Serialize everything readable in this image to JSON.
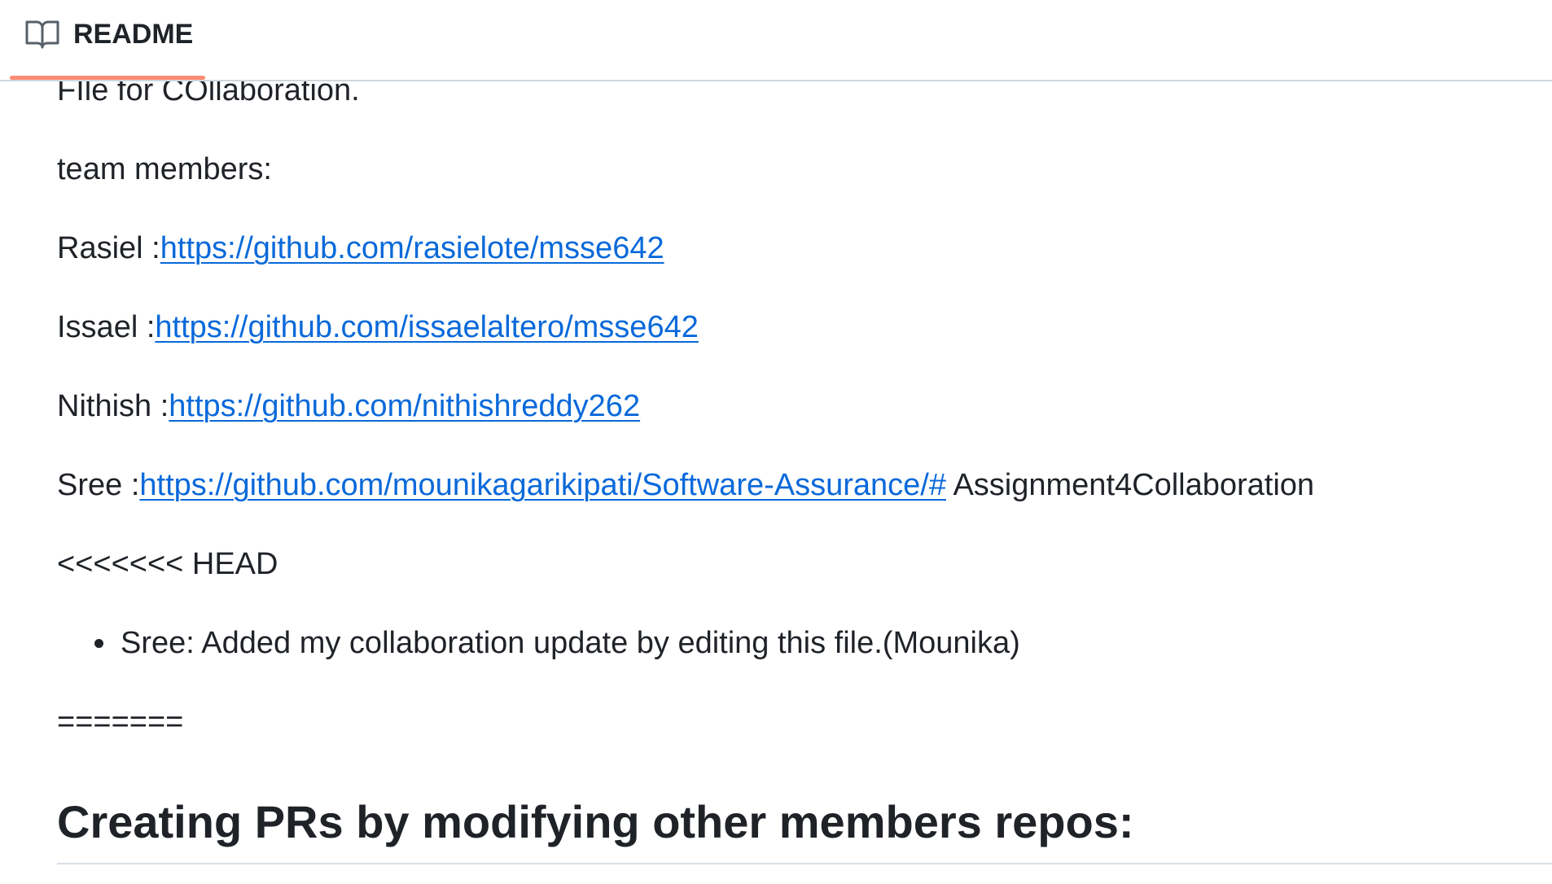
{
  "tab": {
    "icon": "book-icon",
    "label": "README",
    "accent": "#fd8c73"
  },
  "readme": {
    "intro": "FIle for COllaboration.",
    "team_heading": "team members:",
    "members": [
      {
        "prefix": "Rasiel :",
        "link": "https://github.com/rasielote/msse642",
        "suffix": ""
      },
      {
        "prefix": "Issael :",
        "link": "https://github.com/issaelaltero/msse642",
        "suffix": ""
      },
      {
        "prefix": "Nithish :",
        "link": "https://github.com/nithishreddy262",
        "suffix": ""
      },
      {
        "prefix": "Sree :",
        "link": "https://github.com/mounikagarikipati/Software-Assurance/#",
        "suffix": " Assignment4Collaboration"
      }
    ],
    "conflict_head": "<<<<<<< HEAD",
    "bullet": "Sree: Added my collaboration update by editing this file.(Mounika)",
    "separator": "=======",
    "section_heading": "Creating PRs by modifying other members repos:"
  },
  "colors": {
    "link": "#0969da",
    "text": "#1f2328",
    "border": "#d0d7de"
  }
}
